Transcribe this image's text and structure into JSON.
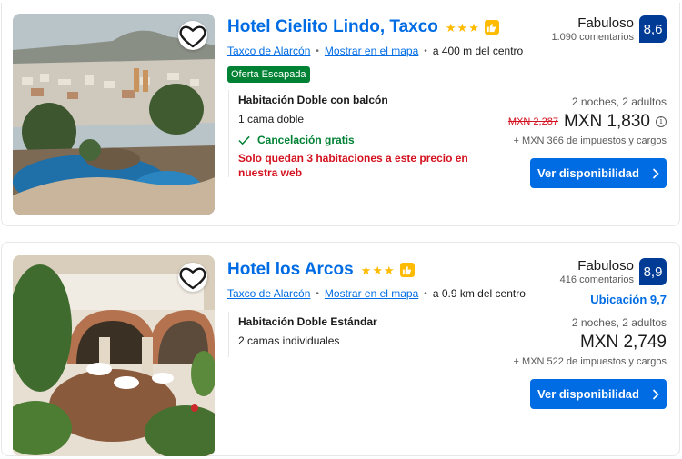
{
  "results": [
    {
      "name": "Hotel Cielito Lindo, Taxco",
      "stars": 3,
      "location_link": "Taxco de Alarcón",
      "map_link": "Mostrar en el mapa",
      "distance": "a 400 m del centro",
      "deal_badge": "Oferta Escapada",
      "review_label": "Fabuloso",
      "review_count": "1.090 comentarios",
      "score": "8,6",
      "room_name": "Habitación Doble con balcón",
      "room_bed": "1 cama doble",
      "cancellation": "Cancelación gratis",
      "scarcity": "Solo quedan 3 habitaciones a este precio en nuestra web",
      "stay": "2 noches, 2 adultos",
      "old_price": "MXN 2,287",
      "price": "MXN 1,830",
      "taxes": "+ MXN 366 de impuestos y cargos",
      "cta": "Ver disponibilidad"
    },
    {
      "name": "Hotel los Arcos",
      "stars": 3,
      "location_link": "Taxco de Alarcón",
      "map_link": "Mostrar en el mapa",
      "distance": "a 0.9 km del centro",
      "review_label": "Fabuloso",
      "review_count": "416 comentarios",
      "score": "8,9",
      "location_score": "Ubicación 9,7",
      "room_name": "Habitación Doble Estándar",
      "room_bed": "2 camas individuales",
      "stay": "2 noches, 2 adultos",
      "price": "MXN 2,749",
      "taxes": "+ MXN 522 de impuestos y cargos",
      "cta": "Ver disponibilidad"
    }
  ],
  "icons": {
    "favorite": "heart-outline-icon",
    "star": "star-icon",
    "preferred": "thumbs-up-icon",
    "check": "check-icon",
    "info": "info-icon",
    "chevron": "chevron-right-icon"
  },
  "colors": {
    "link": "#006ce4",
    "score_bg": "#003b95",
    "deal_green": "#008234",
    "alert_red": "#d4111e",
    "star_yellow": "#febb02"
  }
}
